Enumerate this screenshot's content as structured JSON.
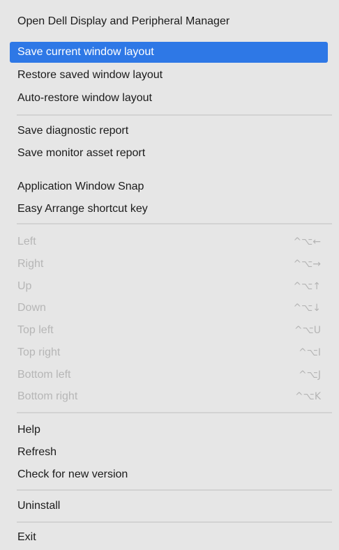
{
  "menu": {
    "items": [
      {
        "label": "Open Dell Display and Peripheral Manager"
      },
      {
        "label": "Save current window layout",
        "selected": true
      },
      {
        "label": "Restore saved window layout"
      },
      {
        "label": "Auto-restore window layout"
      },
      {
        "label": "Save diagnostic report"
      },
      {
        "label": "Save monitor asset report"
      },
      {
        "label": "Application Window Snap"
      },
      {
        "label": "Easy Arrange shortcut key"
      },
      {
        "label": "Left",
        "shortcut": "^⌥←",
        "disabled": true
      },
      {
        "label": "Right",
        "shortcut": "^⌥→",
        "disabled": true
      },
      {
        "label": "Up",
        "shortcut": "^⌥↑",
        "disabled": true
      },
      {
        "label": "Down",
        "shortcut": "^⌥↓",
        "disabled": true
      },
      {
        "label": "Top left",
        "shortcut": "^⌥U",
        "disabled": true
      },
      {
        "label": "Top right",
        "shortcut": "^⌥I",
        "disabled": true
      },
      {
        "label": "Bottom left",
        "shortcut": "^⌥J",
        "disabled": true
      },
      {
        "label": "Bottom right",
        "shortcut": "^⌥K",
        "disabled": true
      },
      {
        "label": "Help"
      },
      {
        "label": "Refresh"
      },
      {
        "label": "Check for new version"
      },
      {
        "label": "Uninstall"
      },
      {
        "label": "Exit"
      }
    ]
  },
  "colors": {
    "menu_background": "#e6e6e6",
    "selection": "#2e78e6",
    "disabled_text": "#b6b6b6"
  }
}
